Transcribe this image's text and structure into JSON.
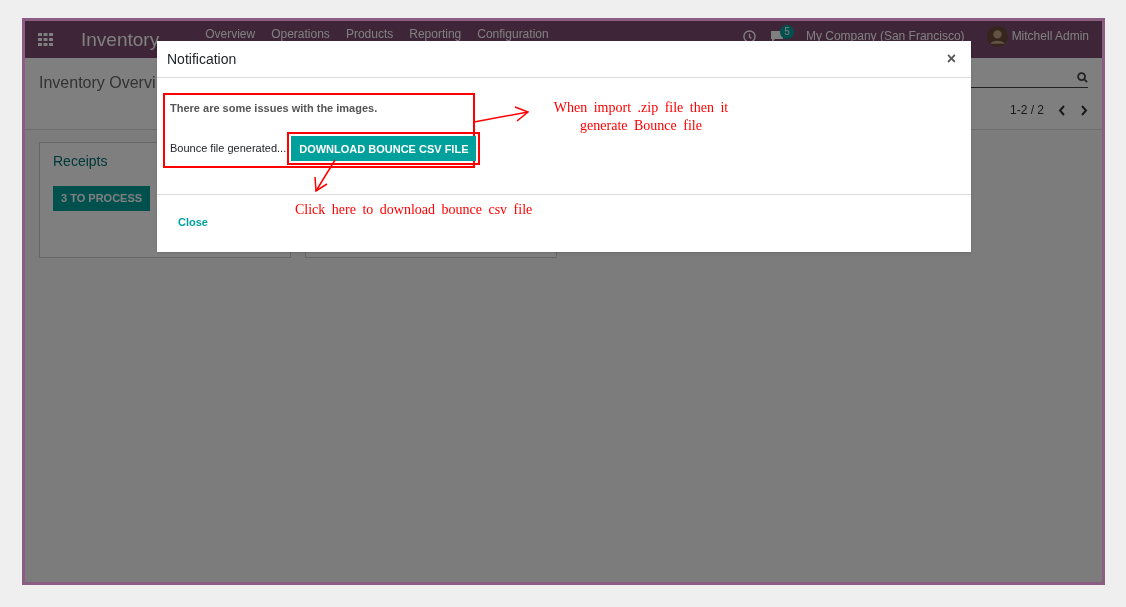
{
  "navbar": {
    "app_title": "Inventory",
    "menu": [
      "Overview",
      "Operations",
      "Products",
      "Reporting",
      "Configuration"
    ],
    "messages_count": "5",
    "company": "My Company (San Francisco)",
    "user": "Mitchell Admin"
  },
  "control_panel": {
    "breadcrumb": "Inventory Overvi",
    "pager": "1-2 / 2"
  },
  "cards": [
    {
      "kind": "card",
      "title": "Receipts",
      "action": "3 TO PROCESS"
    },
    {
      "kind": "covered"
    }
  ],
  "dialog": {
    "title": "Notification",
    "close_icon": "×",
    "message": "There are some issues with the images.",
    "bounce_label": "Bounce file generated...",
    "download_button": "DOWNLOAD BOUNCE CSV FILE",
    "close_button": "Close"
  },
  "annotations": [
    {
      "kind": "side",
      "text": "When import .zip file then it generate Bounce file"
    },
    {
      "kind": "below",
      "text": "Click here to download bounce csv file"
    }
  ]
}
